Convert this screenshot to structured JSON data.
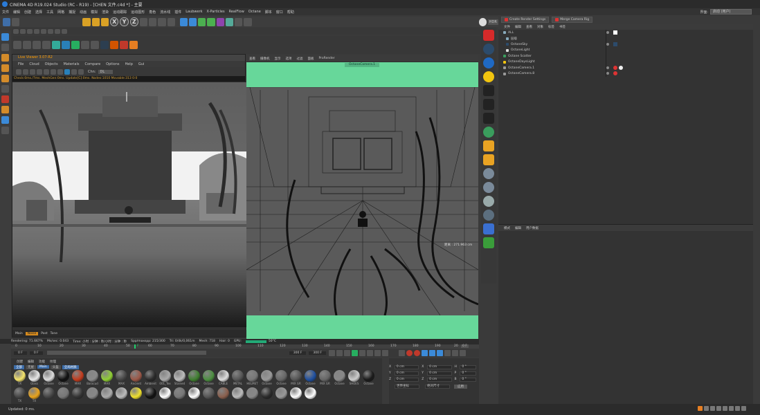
{
  "window": {
    "title": "CINEMA 4D R19.024 Studio (RC - R19) - [CHEN 文件.c4d *] - 主要",
    "controls": [
      "—",
      "□",
      "✕"
    ]
  },
  "menubar": {
    "items": [
      "文件",
      "编辑",
      "创建",
      "选择",
      "工具",
      "网格",
      "捕捉",
      "动画",
      "模拟",
      "渲染",
      "运动跟踪",
      "运动图形",
      "角色",
      "流水线",
      "插件",
      "Laubwerk",
      "X-Particles",
      "RealFlow",
      "Octane",
      "脚本",
      "窗口",
      "帮助"
    ],
    "interface_label": "界面:",
    "interface_value": "启动 (用户)"
  },
  "live_viewer": {
    "title": "Live Viewer 3.07-R2",
    "menu": [
      "File",
      "Cloud",
      "Objects",
      "Materials",
      "Compare",
      "Options",
      "Help",
      "Gui"
    ],
    "channel_label": "Chn:",
    "channel_value": "DL",
    "stats": "Check:0ms./7ms. MeshGen:0ms. Update[C]:0ms. Nodes:1010 Movable:313  0:0",
    "bottom_tabs": [
      "Main",
      "Noise",
      "Post",
      "Tone"
    ]
  },
  "viewport": {
    "menu": [
      "查看",
      "摄像机",
      "显示",
      "选项",
      "过滤",
      "面板",
      "ProRender"
    ],
    "camera_label": "OctaneCamera.1",
    "distance": "距离 : 271.963 cm"
  },
  "status": {
    "rendering": "Rendering: 71.667%",
    "ms_sec": "Ms/sec: 0.043",
    "time": "Time: 小时 : 分钟 : 秒/小时 : 分钟 : 秒",
    "spp": "Spp/maxspp: 215/300",
    "tri": "Tri: 0/4k/0,061m",
    "mesh": "Mesh: 718",
    "hair": "Hair: 0",
    "gpu": "GPU:",
    "temp": "50°C"
  },
  "timeline": {
    "ticks": [
      "0",
      "10",
      "20",
      "30",
      "40",
      "50",
      "60",
      "70",
      "80",
      "90",
      "100",
      "110",
      "120",
      "130",
      "140",
      "150",
      "160",
      "170",
      "180",
      "190",
      "20"
    ],
    "current": "F",
    "end": "0 F"
  },
  "transport": {
    "start": "0 F",
    "mid": "0 F",
    "end": "300 F",
    "end2": "300 F"
  },
  "object_manager": {
    "buttons": [
      "Create Render Settings",
      "Merge Camera Rig"
    ],
    "menu": [
      "文件",
      "编辑",
      "查看",
      "对象",
      "标签",
      "书签"
    ],
    "objects": [
      {
        "name": "ALL"
      },
      {
        "name": "层级"
      },
      {
        "name": "OctaneSky"
      },
      {
        "name": "OctaneLight"
      },
      {
        "name": "Octane Scatter"
      },
      {
        "name": "OctaneDaysLight"
      },
      {
        "name": "OctaneCamera.1"
      },
      {
        "name": "OctaneCamera.8"
      }
    ]
  },
  "attribute_manager": {
    "menu": [
      "模式",
      "编辑",
      "用户数据"
    ]
  },
  "material_manager": {
    "menu": [
      "创建",
      "编辑",
      "功能",
      "纹理"
    ],
    "tabs": [
      "全部",
      "无屋",
      "Main",
      "头盔",
      "全局材质"
    ],
    "materials": [
      {
        "label": "TX",
        "color": "#f4e36a"
      },
      {
        "label": "Glass",
        "color": "#e8e8e8"
      },
      {
        "label": "Octane",
        "color": "#dcdcdc"
      },
      {
        "label": "Octane",
        "color": "#111111"
      },
      {
        "label": "MAX",
        "color": "#c33b1d"
      },
      {
        "label": "Baracud",
        "color": "#8a8a8a"
      },
      {
        "label": "MAX",
        "color": "#8fcf33"
      },
      {
        "label": "MAX",
        "color": "#444444"
      },
      {
        "label": "Ancient",
        "color": "#9b5747"
      },
      {
        "label": "Ambient",
        "color": "#2a2a2a"
      },
      {
        "label": "001_Tex",
        "color": "#aaaaaa"
      },
      {
        "label": "Stained",
        "color": "#bcbcbc"
      },
      {
        "label": "Octane",
        "color": "#3f7f2f"
      },
      {
        "label": "Octane",
        "color": "#4b8f3f"
      },
      {
        "label": "CABLE",
        "color": "#dddddd"
      },
      {
        "label": "METAL",
        "color": "#555555"
      },
      {
        "label": "HELMET",
        "color": "#777777"
      },
      {
        "label": "Octane",
        "color": "#999999"
      },
      {
        "label": "Octane",
        "color": "#666666"
      },
      {
        "label": "MIX GR",
        "color": "#555555"
      },
      {
        "label": "Octane",
        "color": "#1e4fa0"
      },
      {
        "label": "MIX GR",
        "color": "#666666"
      },
      {
        "label": "Octane",
        "color": "#888888"
      },
      {
        "label": "SHOES",
        "color": "#cccccc"
      },
      {
        "label": "Octane",
        "color": "#1a1a1a"
      },
      {
        "label": "TX",
        "color": "#444444"
      },
      {
        "label": "TX",
        "color": "#e8a31c"
      },
      {
        "label": "",
        "color": "#444444"
      },
      {
        "label": "",
        "color": "#777777"
      },
      {
        "label": "",
        "color": "#333333"
      },
      {
        "label": "",
        "color": "#888888"
      },
      {
        "label": "",
        "color": "#aaaaaa"
      },
      {
        "label": "",
        "color": "#bbbbbb"
      },
      {
        "label": "",
        "color": "#efe02d"
      },
      {
        "label": "",
        "color": "#111111"
      },
      {
        "label": "",
        "color": "#ffffff"
      },
      {
        "label": "",
        "color": "#777777"
      },
      {
        "label": "",
        "color": "#ffffff"
      },
      {
        "label": "",
        "color": "#555555"
      },
      {
        "label": "",
        "color": "#8a5f4d"
      },
      {
        "label": "",
        "color": "#bbbbbb"
      },
      {
        "label": "",
        "color": "#888888"
      },
      {
        "label": "",
        "color": "#2a2a2a"
      },
      {
        "label": "",
        "color": "#999999"
      },
      {
        "label": "",
        "color": "#ffffff"
      },
      {
        "label": "",
        "color": "#ffffff"
      }
    ]
  },
  "coords": {
    "labels": [
      "X",
      "Y",
      "Z"
    ],
    "pos": [
      "0 cm",
      "0 cm",
      "0 cm"
    ],
    "size": [
      "0 cm",
      "0 cm",
      "0 cm"
    ],
    "rot_labels": [
      "H",
      "P",
      "B"
    ],
    "rot": [
      "0 °",
      "0 °",
      "0 °"
    ],
    "mode": "世界坐标",
    "scale": "绝对尺寸",
    "apply": "应用"
  },
  "bottom_status": "Updated: 0 ms."
}
